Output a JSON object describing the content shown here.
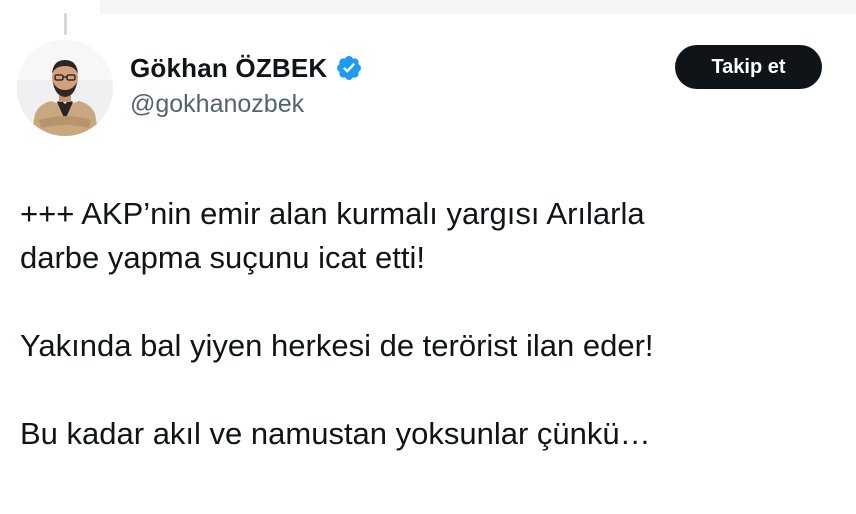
{
  "tweet": {
    "author": {
      "display_name": "Gökhan ÖZBEK",
      "handle": "@gokhanozbek",
      "verified": true,
      "verified_icon": "verified-badge-icon",
      "avatar": "profile-photo"
    },
    "follow_label": "Takip et",
    "body": {
      "para1_line1": "+++ AKP’nin emir alan kurmalı yargısı Arılarla",
      "para1_line2": "darbe yapma suçunu icat etti!",
      "para2": "Yakında bal yiyen herkesi de terörist ilan eder!",
      "para3": "Bu kadar akıl ve namustan yoksunlar çünkü…"
    }
  },
  "colors": {
    "text": "#0f1419",
    "secondary_text": "#536471",
    "verified_blue": "#1d9bf0",
    "button_bg": "#0f1419",
    "button_text": "#ffffff"
  }
}
